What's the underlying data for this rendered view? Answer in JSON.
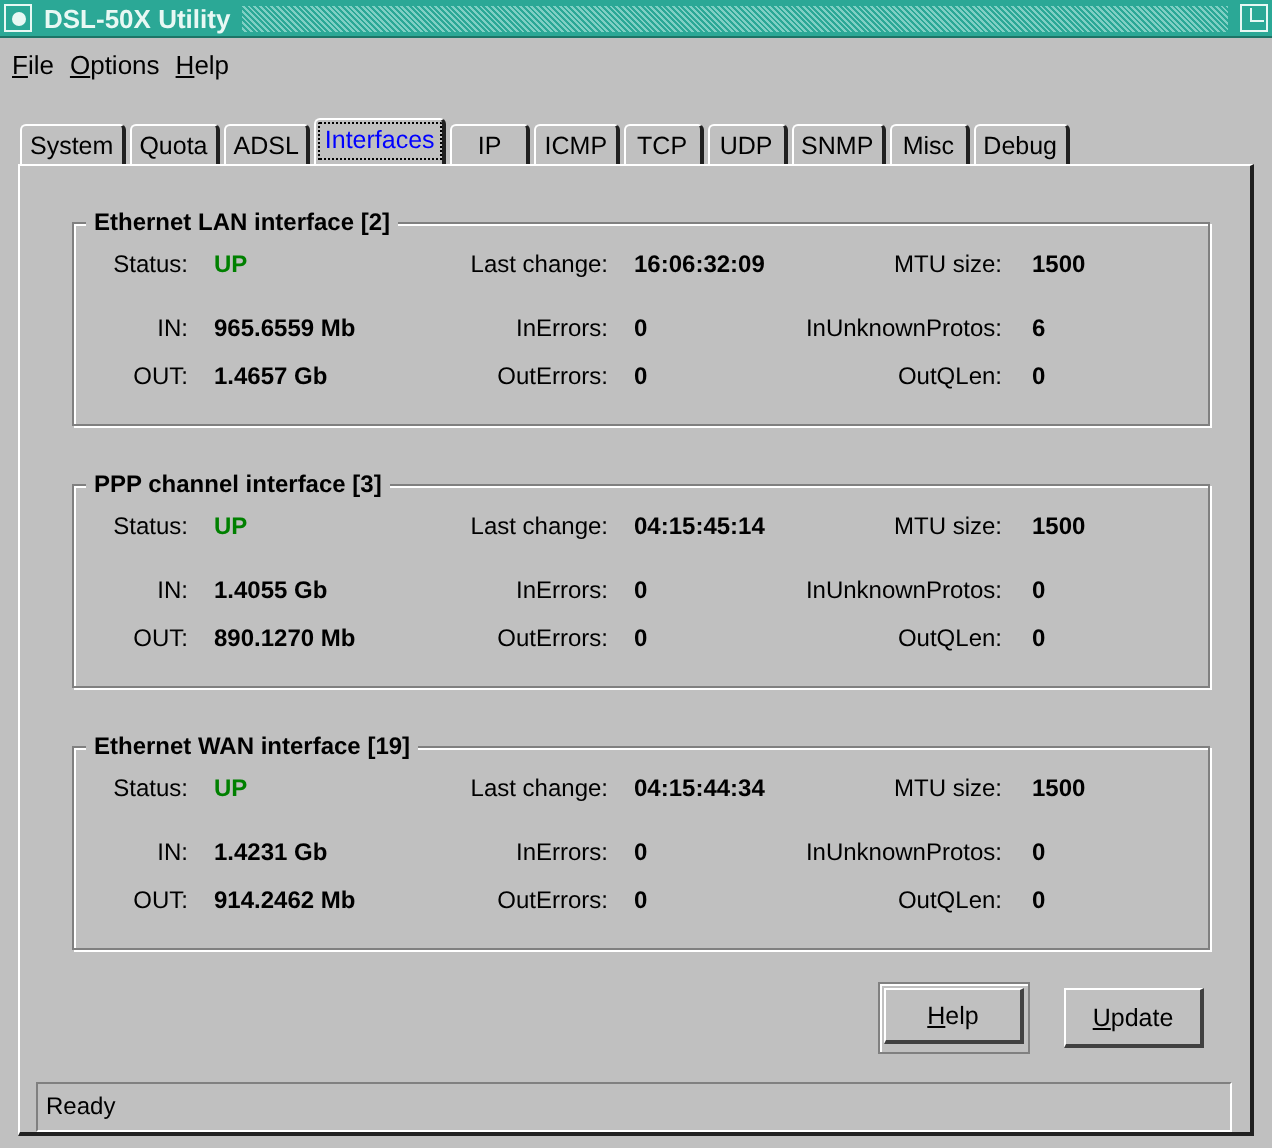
{
  "window": {
    "title": "DSL-50X Utility"
  },
  "menu": [
    {
      "label": "File"
    },
    {
      "label": "Options"
    },
    {
      "label": "Help"
    }
  ],
  "tabs": [
    {
      "label": "System",
      "selected": false
    },
    {
      "label": "Quota",
      "selected": false
    },
    {
      "label": "ADSL",
      "selected": false
    },
    {
      "label": "Interfaces",
      "selected": true
    },
    {
      "label": "IP",
      "selected": false
    },
    {
      "label": "ICMP",
      "selected": false
    },
    {
      "label": "TCP",
      "selected": false
    },
    {
      "label": "UDP",
      "selected": false
    },
    {
      "label": "SNMP",
      "selected": false
    },
    {
      "label": "Misc",
      "selected": false
    },
    {
      "label": "Debug",
      "selected": false
    }
  ],
  "groups": [
    {
      "title": "Ethernet LAN interface [2]",
      "status_label": "Status:",
      "status": {
        "value": "UP",
        "color": "#008000"
      },
      "last_change_label": "Last change:",
      "last_change": "16:06:32:09",
      "mtu_label": "MTU size:",
      "mtu": "1500",
      "in_label": "IN:",
      "in": "965.6559 Mb",
      "in_errors_label": "InErrors:",
      "in_errors": "0",
      "in_unknown_label": "InUnknownProtos:",
      "in_unknown": "6",
      "out_label": "OUT:",
      "out": "1.4657 Gb",
      "out_errors_label": "OutErrors:",
      "out_errors": "0",
      "out_qlen_label": "OutQLen:",
      "out_qlen": "0"
    },
    {
      "title": "PPP channel interface [3]",
      "status_label": "Status:",
      "status": {
        "value": "UP",
        "color": "#008000"
      },
      "last_change_label": "Last change:",
      "last_change": "04:15:45:14",
      "mtu_label": "MTU size:",
      "mtu": "1500",
      "in_label": "IN:",
      "in": "1.4055 Gb",
      "in_errors_label": "InErrors:",
      "in_errors": "0",
      "in_unknown_label": "InUnknownProtos:",
      "in_unknown": "0",
      "out_label": "OUT:",
      "out": "890.1270 Mb",
      "out_errors_label": "OutErrors:",
      "out_errors": "0",
      "out_qlen_label": "OutQLen:",
      "out_qlen": "0"
    },
    {
      "title": "Ethernet WAN interface [19]",
      "status_label": "Status:",
      "status": {
        "value": "UP",
        "color": "#008000"
      },
      "last_change_label": "Last change:",
      "last_change": "04:15:44:34",
      "mtu_label": "MTU size:",
      "mtu": "1500",
      "in_label": "IN:",
      "in": "1.4231 Gb",
      "in_errors_label": "InErrors:",
      "in_errors": "0",
      "in_unknown_label": "InUnknownProtos:",
      "in_unknown": "0",
      "out_label": "OUT:",
      "out": "914.2462 Mb",
      "out_errors_label": "OutErrors:",
      "out_errors": "0",
      "out_qlen_label": "OutQLen:",
      "out_qlen": "0"
    }
  ],
  "buttons": [
    {
      "label": "Help",
      "default": true
    },
    {
      "label": "Update",
      "default": false
    }
  ],
  "status_bar": "Ready"
}
